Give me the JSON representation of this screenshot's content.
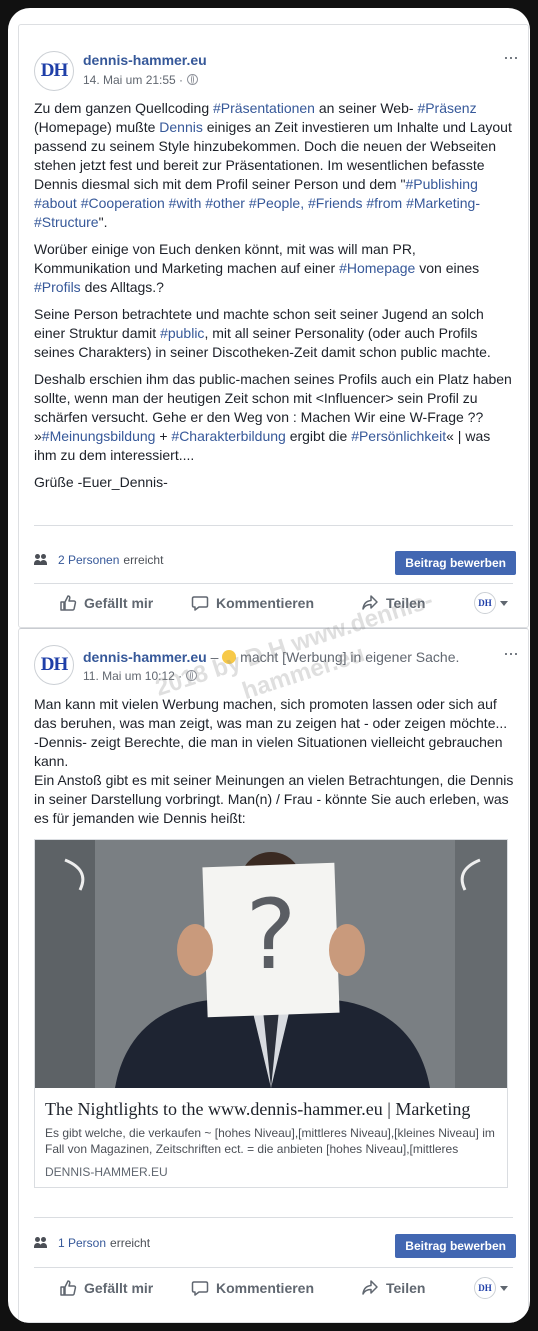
{
  "post1": {
    "avatar_text": "DH",
    "page_name": "dennis-hammer.eu",
    "timestamp": "14. Mai um 21:55 ·",
    "more": "···",
    "paragraphs": [
      [
        {
          "t": "Zu dem ganzen Quellcoding "
        },
        {
          "t": "#Präsentationen",
          "tag": true
        },
        {
          "t": " an seiner Web- "
        },
        {
          "t": "#Präsenz",
          "tag": true
        },
        {
          "t": " (Homepage) mußte "
        },
        {
          "t": "Dennis",
          "tag": true
        },
        {
          "t": " einiges an Zeit investieren um Inhalte und Layout passend zu seinem Style hinzubekommen. Doch die neuen der Webseiten stehen jetzt fest und bereit zur Präsentationen. Im wesentlichen befasste Dennis diesmal sich mit dem Profil seiner Person und dem \""
        },
        {
          "t": "#Publishing",
          "tag": true
        },
        {
          "t": " "
        },
        {
          "t": "#about",
          "tag": true
        },
        {
          "t": " "
        },
        {
          "t": "#Cooperation",
          "tag": true
        },
        {
          "t": " "
        },
        {
          "t": "#with",
          "tag": true
        },
        {
          "t": " "
        },
        {
          "t": "#other",
          "tag": true
        },
        {
          "t": " "
        },
        {
          "t": "#People,",
          "tag": true
        },
        {
          "t": " "
        },
        {
          "t": "#Friends",
          "tag": true
        },
        {
          "t": " "
        },
        {
          "t": "#from",
          "tag": true
        },
        {
          "t": " "
        },
        {
          "t": "#Marketing-#Structure",
          "tag": true
        },
        {
          "t": "\"."
        }
      ],
      [
        {
          "t": "Worüber einige von Euch denken könnt, mit was will man PR, Kommunikation und Marketing machen auf einer "
        },
        {
          "t": "#Homepage",
          "tag": true
        },
        {
          "t": " von eines "
        },
        {
          "t": "#Profils",
          "tag": true
        },
        {
          "t": " des Alltags.?"
        }
      ],
      [
        {
          "t": "Seine Person betrachtete und machte schon seit seiner Jugend an solch einer Struktur damit "
        },
        {
          "t": "#public",
          "tag": true
        },
        {
          "t": ", mit all seiner Personality (oder auch Profils seines Charakters) in seiner Discotheken-Zeit damit schon public machte."
        }
      ],
      [
        {
          "t": "Deshalb erschien ihm das public-machen seines Profils auch ein Platz haben sollte, wenn man der heutigen Zeit schon mit <Influencer> sein Profil zu schärfen versucht. Gehe er den Weg von : Machen Wir eine W-Frage ??\n»"
        },
        {
          "t": "#Meinungsbildung",
          "tag": true
        },
        {
          "t": " + "
        },
        {
          "t": "#Charakterbildung",
          "tag": true
        },
        {
          "t": " ergibt die "
        },
        {
          "t": "#Persönlichkeit",
          "tag": true
        },
        {
          "t": "« | was ihm zu dem interessiert...."
        }
      ],
      [
        {
          "t": "Grüße -Euer_Dennis-"
        }
      ]
    ],
    "reach_count": "2 Personen",
    "reach_label": "erreicht",
    "boost_label": "Beitrag bewerben",
    "actions": {
      "like": "Gefällt mir",
      "comment": "Kommentieren",
      "share": "Teilen"
    }
  },
  "post2": {
    "avatar_text": "DH",
    "page_name": "dennis-hammer.eu",
    "activity_prefix": " – ",
    "activity": "macht [Werbung] in eigener Sache.",
    "timestamp": "11. Mai um 10:12 ·",
    "more": "···",
    "watermark": "2018 by D.H www.dennis-hammer.eu",
    "text": "Man kann mit vielen Werbung machen, sich promoten lassen oder sich auf das beruhen, was man zeigt, was man zu zeigen hat - oder zeigen möchte... -Dennis- zeigt Berechte, die man in vielen Situationen vielleicht gebrauchen kann.\nEin Anstoß gibt es mit seiner Meinungen an vielen Betrachtungen, die Dennis in seiner Darstellung vorbringt. Man(n) / Frau - könnte Sie auch erleben, was es für jemanden wie Dennis heißt:",
    "link": {
      "sign_glyph": "?",
      "title": "The Nightlights to the www.dennis-hammer.eu | Marketing",
      "description": "Es gibt welche, die verkaufen ~ [hohes Niveau],[mittleres Niveau],[kleines Niveau] im Fall von Magazinen, Zeitschriften ect. = die anbieten [hohes Niveau],[mittleres Niveau],[kleines Niveau]",
      "domain": "DENNIS-HAMMER.EU"
    },
    "reach_count": "1 Person",
    "reach_label": "erreicht",
    "boost_label": "Beitrag bewerben",
    "actions": {
      "like": "Gefällt mir",
      "comment": "Kommentieren",
      "share": "Teilen"
    }
  },
  "colors": {
    "link": "#365899",
    "boost": "#4267b2",
    "text": "#1d2129",
    "meta": "#616770"
  }
}
